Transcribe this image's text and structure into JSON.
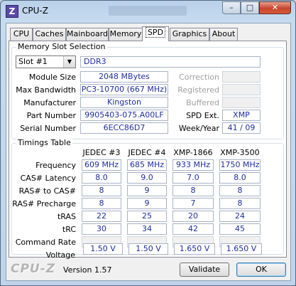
{
  "window": {
    "title": "CPU-Z",
    "icon_letter": "Z",
    "min": "–",
    "max": "□",
    "close": "✕"
  },
  "tabs": [
    {
      "label": "CPU"
    },
    {
      "label": "Caches"
    },
    {
      "label": "Mainboard"
    },
    {
      "label": "Memory"
    },
    {
      "label": "SPD",
      "active": true
    },
    {
      "label": "Graphics"
    },
    {
      "label": "About"
    }
  ],
  "slot_group": {
    "title": "Memory Slot Selection",
    "slot_selected": "Slot #1",
    "memory_type": "DDR3",
    "fields": {
      "module_size": {
        "label": "Module Size",
        "value": "2048 MBytes"
      },
      "max_bandwidth": {
        "label": "Max Bandwidth",
        "value": "PC3-10700 (667 MHz)"
      },
      "manufacturer": {
        "label": "Manufacturer",
        "value": "Kingston"
      },
      "part_number": {
        "label": "Part Number",
        "value": "9905403-075.A00LF"
      },
      "serial_number": {
        "label": "Serial Number",
        "value": "6ECC86D7"
      },
      "correction": {
        "label": "Correction",
        "value": ""
      },
      "registered": {
        "label": "Registered",
        "value": ""
      },
      "buffered": {
        "label": "Buffered",
        "value": ""
      },
      "spd_ext": {
        "label": "SPD Ext.",
        "value": "XMP"
      },
      "week_year": {
        "label": "Week/Year",
        "value": "41 / 09"
      }
    }
  },
  "timings": {
    "title": "Timings Table",
    "columns": [
      "JEDEC #3",
      "JEDEC #4",
      "XMP-1866",
      "XMP-3500"
    ],
    "rows": [
      {
        "label": "Frequency",
        "values": [
          "609 MHz",
          "685 MHz",
          "933 MHz",
          "1750 MHz"
        ]
      },
      {
        "label": "CAS# Latency",
        "values": [
          "8.0",
          "9.0",
          "7.0",
          "8.0"
        ]
      },
      {
        "label": "RAS# to CAS#",
        "values": [
          "8",
          "9",
          "8",
          "8"
        ]
      },
      {
        "label": "RAS# Precharge",
        "values": [
          "8",
          "9",
          "7",
          "8"
        ]
      },
      {
        "label": "tRAS",
        "values": [
          "22",
          "25",
          "20",
          "24"
        ]
      },
      {
        "label": "tRC",
        "values": [
          "30",
          "34",
          "42",
          "45"
        ]
      },
      {
        "label": "Command Rate",
        "values": [
          "",
          "",
          "",
          ""
        ]
      },
      {
        "label": "Voltage",
        "values": [
          "1.50 V",
          "1.50 V",
          "1.650 V",
          "1.650 V"
        ]
      }
    ]
  },
  "footer": {
    "brand": "CPU-Z",
    "version": "Version 1.57",
    "validate": "Validate",
    "ok": "OK"
  }
}
